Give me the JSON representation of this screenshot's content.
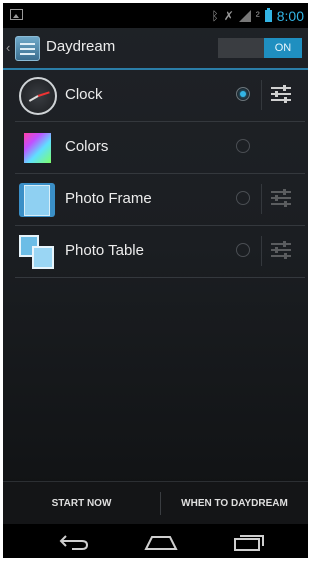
{
  "status_bar": {
    "time": "8:00",
    "icons": [
      "image-notification-icon",
      "bluetooth-icon",
      "no-sim-icon",
      "signal-icon",
      "data-2g-icon",
      "battery-icon"
    ]
  },
  "action_bar": {
    "title": "Daydream",
    "toggle_label": "ON",
    "toggle_state": "on"
  },
  "list": {
    "items": [
      {
        "label": "Clock",
        "icon": "clock-icon",
        "selected": true,
        "settings_enabled": true
      },
      {
        "label": "Colors",
        "icon": "colors-icon",
        "selected": false,
        "settings_enabled": false
      },
      {
        "label": "Photo Frame",
        "icon": "photo-frame-icon",
        "selected": false,
        "settings_enabled": true
      },
      {
        "label": "Photo Table",
        "icon": "photo-table-icon",
        "selected": false,
        "settings_enabled": true
      }
    ]
  },
  "buttons": {
    "start_now": "START NOW",
    "when_to_daydream": "WHEN TO DAYDREAM"
  },
  "navigation": [
    "back-icon",
    "home-icon",
    "recents-icon"
  ],
  "colors": {
    "accent": "#33b5e5",
    "toggle_on": "#1f8fc0",
    "background": "#1c1f23"
  }
}
